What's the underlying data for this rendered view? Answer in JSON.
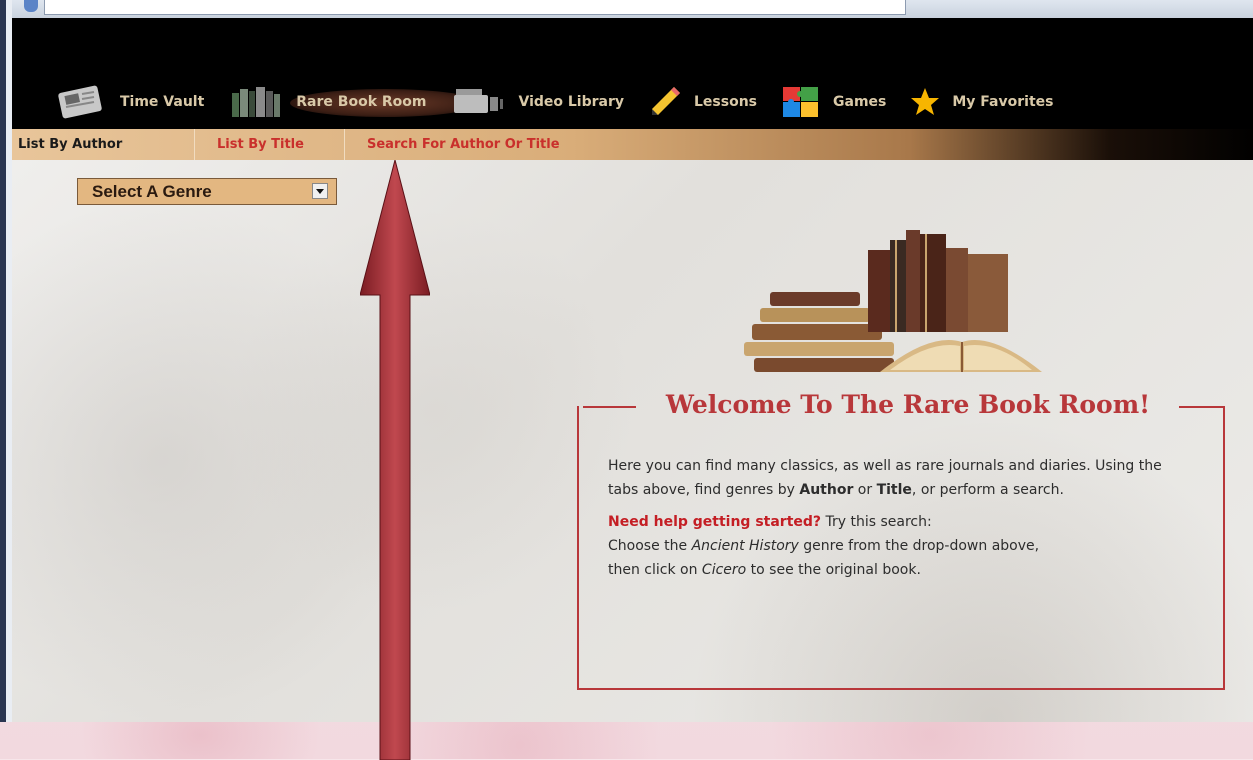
{
  "nav": {
    "items": [
      {
        "label": "Time Vault",
        "icon": "newspaper-icon"
      },
      {
        "label": "Rare Book Room",
        "icon": "books-icon"
      },
      {
        "label": "Video Library",
        "icon": "video-camera-icon"
      },
      {
        "label": "Lessons",
        "icon": "pencil-icon"
      },
      {
        "label": "Games",
        "icon": "puzzle-icon"
      },
      {
        "label": "My Favorites",
        "icon": "star-icon"
      }
    ],
    "active_index": 1
  },
  "subtabs": {
    "by_author": "List By Author",
    "by_title": "List By Title",
    "search": "Search For Author Or Title"
  },
  "genre_select": {
    "value": "Select A Genre"
  },
  "welcome": {
    "title": "Welcome To The Rare Book Room!",
    "para1_pre": "Here you can find many classics, as well as rare journals and diaries. Using the tabs above, find genres by ",
    "para1_author": "Author",
    "para1_or": " or ",
    "para1_title": "Title",
    "para1_post": ", or perform a search.",
    "help_label": "Need help getting started?",
    "help_text": " Try this search:",
    "line2_pre": "Choose the ",
    "line2_genre": "Ancient History",
    "line2_post": " genre from the drop-down above,",
    "line3_pre": "then click on ",
    "line3_author": "Cicero",
    "line3_post": " to see the original book."
  },
  "colors": {
    "accent": "#b8373a",
    "link": "#c9302c",
    "nav_text": "#d9c9a8",
    "header_bg": "#000000"
  }
}
